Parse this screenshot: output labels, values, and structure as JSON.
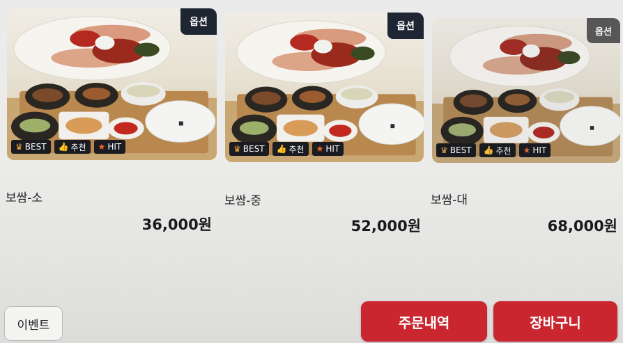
{
  "menu": {
    "items": [
      {
        "name": "보쌈-소",
        "price": "36,000원",
        "option_badge": "옵션",
        "tags": [
          {
            "icon": "crown-icon",
            "label": "BEST"
          },
          {
            "icon": "thumbs-up-icon",
            "label": "추천"
          },
          {
            "icon": "star-icon",
            "label": "HIT"
          }
        ]
      },
      {
        "name": "보쌈-중",
        "price": "52,000원",
        "option_badge": "옵션",
        "tags": [
          {
            "icon": "crown-icon",
            "label": "BEST"
          },
          {
            "icon": "thumbs-up-icon",
            "label": "추천"
          },
          {
            "icon": "star-icon",
            "label": "HIT"
          }
        ]
      },
      {
        "name": "보쌈-대",
        "price": "68,000원",
        "option_badge": "옵션",
        "tags": [
          {
            "icon": "crown-icon",
            "label": "BEST"
          },
          {
            "icon": "thumbs-up-icon",
            "label": "추천"
          },
          {
            "icon": "star-icon",
            "label": "HIT"
          }
        ]
      }
    ]
  },
  "footer": {
    "event_label": "이벤트",
    "order_history_label": "주문내역",
    "cart_label": "장바구니"
  },
  "colors": {
    "accent_red": "#c9262f",
    "badge_dark": "#1f2633",
    "tag_dark": "#1a1c22"
  }
}
